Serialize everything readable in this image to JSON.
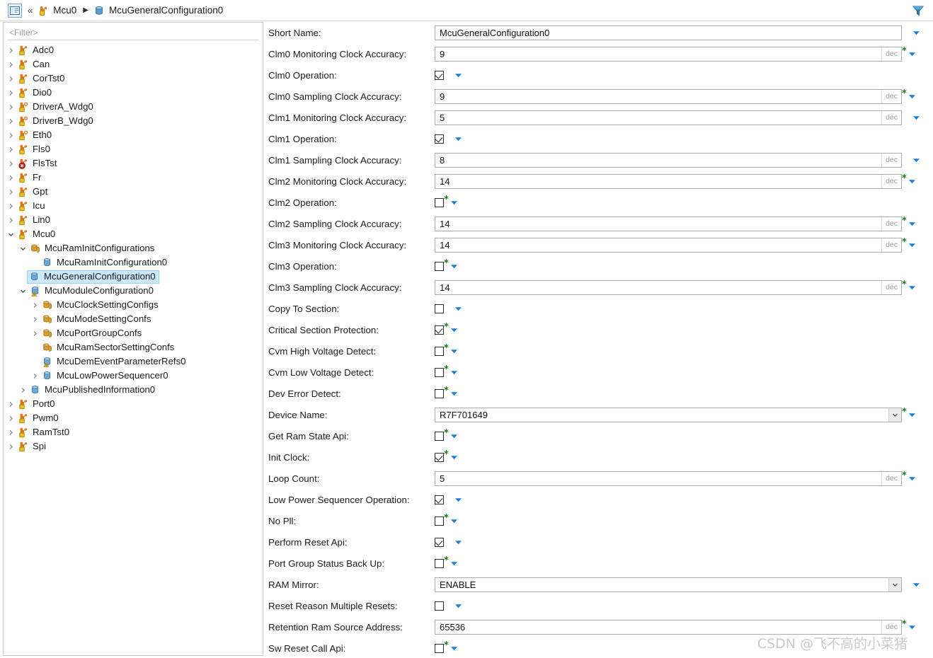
{
  "breadcrumb": {
    "home_icon": "editor-icon",
    "chevrons": "«",
    "separator": "▶",
    "items": [
      {
        "label": "Mcu0",
        "icon": "module-orange-icon"
      },
      {
        "label": "McuGeneralConfiguration0",
        "icon": "container-blue-icon"
      }
    ],
    "filter_icon": "funnel-icon"
  },
  "tree": {
    "filter_placeholder": "<Filter>",
    "items": [
      {
        "label": "Adc0",
        "depth": 0,
        "twisty": "collapsed",
        "icon": "module-orange-icon",
        "selected": false
      },
      {
        "label": "Can",
        "depth": 0,
        "twisty": "collapsed",
        "icon": "module-orange-icon",
        "selected": false
      },
      {
        "label": "CorTst0",
        "depth": 0,
        "twisty": "collapsed",
        "icon": "module-orange-icon",
        "selected": false
      },
      {
        "label": "Dio0",
        "depth": 0,
        "twisty": "collapsed",
        "icon": "module-orange-icon",
        "selected": false
      },
      {
        "label": "DriverA_Wdg0",
        "depth": 0,
        "twisty": "collapsed",
        "icon": "module-orange-ring-icon",
        "selected": false
      },
      {
        "label": "DriverB_Wdg0",
        "depth": 0,
        "twisty": "collapsed",
        "icon": "module-orange-ring-icon",
        "selected": false
      },
      {
        "label": "Eth0",
        "depth": 0,
        "twisty": "collapsed",
        "icon": "module-orange-ring-icon",
        "selected": false
      },
      {
        "label": "Fls0",
        "depth": 0,
        "twisty": "collapsed",
        "icon": "module-orange-icon",
        "selected": false
      },
      {
        "label": "FlsTst",
        "depth": 0,
        "twisty": "collapsed",
        "icon": "module-orange-error-icon",
        "selected": false
      },
      {
        "label": "Fr",
        "depth": 0,
        "twisty": "collapsed",
        "icon": "module-orange-icon",
        "selected": false
      },
      {
        "label": "Gpt",
        "depth": 0,
        "twisty": "collapsed",
        "icon": "module-orange-icon",
        "selected": false
      },
      {
        "label": "Icu",
        "depth": 0,
        "twisty": "collapsed",
        "icon": "module-orange-icon",
        "selected": false
      },
      {
        "label": "Lin0",
        "depth": 0,
        "twisty": "collapsed",
        "icon": "module-orange-icon",
        "selected": false
      },
      {
        "label": "Mcu0",
        "depth": 0,
        "twisty": "expanded",
        "icon": "module-orange-icon",
        "selected": false
      },
      {
        "label": "McuRamInitConfigurations",
        "depth": 1,
        "twisty": "expanded",
        "icon": "container-gold-icon",
        "selected": false
      },
      {
        "label": "McuRamInitConfiguration0",
        "depth": 2,
        "twisty": "none",
        "icon": "container-blue-icon",
        "selected": false
      },
      {
        "label": "McuGeneralConfiguration0",
        "depth": 1,
        "twisty": "none",
        "icon": "container-blue-icon",
        "selected": true
      },
      {
        "label": "McuModuleConfiguration0",
        "depth": 1,
        "twisty": "expanded",
        "icon": "container-blue-warn-icon",
        "selected": false
      },
      {
        "label": "McuClockSettingConfigs",
        "depth": 2,
        "twisty": "collapsed",
        "icon": "container-gold-icon",
        "selected": false
      },
      {
        "label": "McuModeSettingConfs",
        "depth": 2,
        "twisty": "collapsed",
        "icon": "container-gold-icon",
        "selected": false
      },
      {
        "label": "McuPortGroupConfs",
        "depth": 2,
        "twisty": "collapsed",
        "icon": "container-gold-icon",
        "selected": false
      },
      {
        "label": "McuRamSectorSettingConfs",
        "depth": 2,
        "twisty": "none",
        "icon": "container-gold-icon",
        "selected": false
      },
      {
        "label": "McuDemEventParameterRefs0",
        "depth": 2,
        "twisty": "none",
        "icon": "container-blue-warn-icon",
        "selected": false
      },
      {
        "label": "McuLowPowerSequencer0",
        "depth": 2,
        "twisty": "collapsed",
        "icon": "container-blue-icon",
        "selected": false
      },
      {
        "label": "McuPublishedInformation0",
        "depth": 1,
        "twisty": "collapsed",
        "icon": "container-blue-icon",
        "selected": false
      },
      {
        "label": "Port0",
        "depth": 0,
        "twisty": "collapsed",
        "icon": "module-orange-icon",
        "selected": false
      },
      {
        "label": "Pwm0",
        "depth": 0,
        "twisty": "collapsed",
        "icon": "module-orange-icon",
        "selected": false
      },
      {
        "label": "RamTst0",
        "depth": 0,
        "twisty": "collapsed",
        "icon": "module-orange-icon",
        "selected": false
      },
      {
        "label": "Spi",
        "depth": 0,
        "twisty": "collapsed",
        "icon": "module-orange-icon",
        "selected": false
      }
    ]
  },
  "form": {
    "rows": [
      {
        "label": "Short Name:",
        "type": "text",
        "value": "McuGeneralConfiguration0",
        "radix": "",
        "overridden": false
      },
      {
        "label": "Clm0 Monitoring Clock Accuracy:",
        "type": "text",
        "value": "9",
        "radix": "dec",
        "overridden": true
      },
      {
        "label": "Clm0 Operation:",
        "type": "checkbox",
        "checked": true,
        "overridden": false
      },
      {
        "label": "Clm0 Sampling Clock Accuracy:",
        "type": "text",
        "value": "9",
        "radix": "dec",
        "overridden": true
      },
      {
        "label": "Clm1 Monitoring Clock Accuracy:",
        "type": "text",
        "value": "5",
        "radix": "dec",
        "overridden": false
      },
      {
        "label": "Clm1 Operation:",
        "type": "checkbox",
        "checked": true,
        "overridden": false
      },
      {
        "label": "Clm1 Sampling Clock Accuracy:",
        "type": "text",
        "value": "8",
        "radix": "dec",
        "overridden": false
      },
      {
        "label": "Clm2 Monitoring Clock Accuracy:",
        "type": "text",
        "value": "14",
        "radix": "dec",
        "overridden": true
      },
      {
        "label": "Clm2 Operation:",
        "type": "checkbox",
        "checked": false,
        "overridden": true
      },
      {
        "label": "Clm2 Sampling Clock Accuracy:",
        "type": "text",
        "value": "14",
        "radix": "dec",
        "overridden": true
      },
      {
        "label": "Clm3 Monitoring Clock Accuracy:",
        "type": "text",
        "value": "14",
        "radix": "dec",
        "overridden": true
      },
      {
        "label": "Clm3 Operation:",
        "type": "checkbox",
        "checked": false,
        "overridden": true
      },
      {
        "label": "Clm3 Sampling Clock Accuracy:",
        "type": "text",
        "value": "14",
        "radix": "dec",
        "overridden": true
      },
      {
        "label": "Copy To Section:",
        "type": "checkbox",
        "checked": false,
        "overridden": false
      },
      {
        "label": "Critical Section Protection:",
        "type": "checkbox",
        "checked": true,
        "overridden": true
      },
      {
        "label": "Cvm High Voltage Detect:",
        "type": "checkbox",
        "checked": false,
        "overridden": true
      },
      {
        "label": "Cvm Low Voltage Detect:",
        "type": "checkbox",
        "checked": false,
        "overridden": true
      },
      {
        "label": "Dev Error Detect:",
        "type": "checkbox",
        "checked": false,
        "overridden": true
      },
      {
        "label": "Device Name:",
        "type": "combo",
        "value": "R7F701649",
        "overridden": true
      },
      {
        "label": "Get Ram State Api:",
        "type": "checkbox",
        "checked": false,
        "overridden": true
      },
      {
        "label": "Init Clock:",
        "type": "checkbox",
        "checked": true,
        "overridden": true
      },
      {
        "label": "Loop Count:",
        "type": "text",
        "value": "5",
        "radix": "dec",
        "overridden": true
      },
      {
        "label": "Low Power Sequencer Operation:",
        "type": "checkbox",
        "checked": true,
        "overridden": false
      },
      {
        "label": "No Pll:",
        "type": "checkbox",
        "checked": false,
        "overridden": true
      },
      {
        "label": "Perform Reset Api:",
        "type": "checkbox",
        "checked": true,
        "overridden": false
      },
      {
        "label": "Port Group Status Back Up:",
        "type": "checkbox",
        "checked": false,
        "overridden": true
      },
      {
        "label": "RAM Mirror:",
        "type": "combo",
        "value": "ENABLE",
        "overridden": false
      },
      {
        "label": "Reset Reason Multiple Resets:",
        "type": "checkbox",
        "checked": false,
        "overridden": false
      },
      {
        "label": "Retention Ram Source Address:",
        "type": "text",
        "value": "65536",
        "radix": "dec",
        "overridden": true
      },
      {
        "label": "Sw Reset Call Api:",
        "type": "checkbox",
        "checked": false,
        "overridden": true
      }
    ]
  },
  "watermark": "CSDN @飞不高的小菜猪",
  "colors": {
    "accent_blue": "#1f7fd4",
    "selection_bg": "#cce8ff",
    "selection_border": "#99d1ff",
    "override_green": "#1a7a1a",
    "icon_orange": "#e8762c",
    "icon_gold": "#c98b23",
    "icon_blue": "#3f7fb5",
    "radix_gray": "#9a9a9a"
  }
}
